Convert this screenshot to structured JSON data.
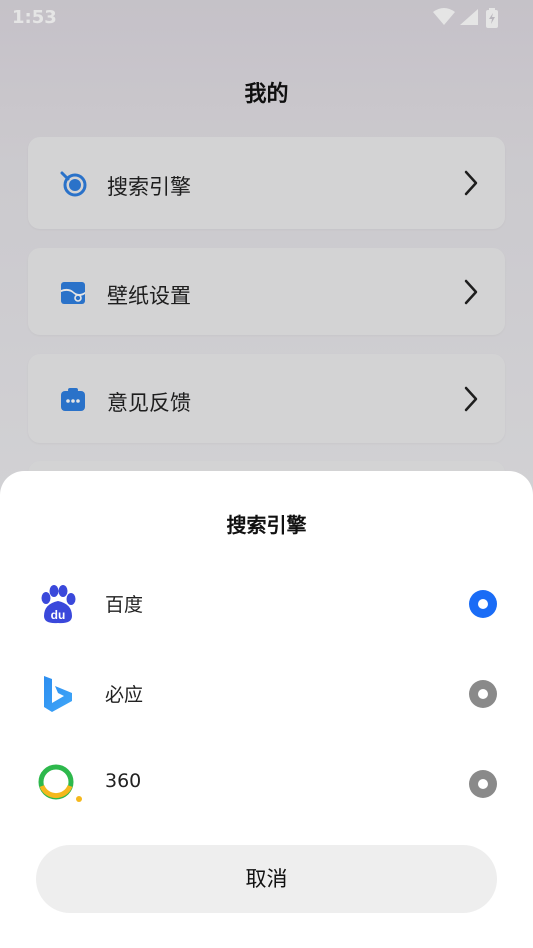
{
  "status_bar": {
    "time": "1:53"
  },
  "page": {
    "title": "我的"
  },
  "menu": [
    {
      "label": "搜索引擎",
      "icon": "search-engine-icon"
    },
    {
      "label": "壁纸设置",
      "icon": "wallpaper-icon"
    },
    {
      "label": "意见反馈",
      "icon": "feedback-icon"
    }
  ],
  "sheet": {
    "title": "搜索引擎",
    "engines": [
      {
        "label": "百度",
        "icon": "baidu-logo-icon",
        "selected": true
      },
      {
        "label": "必应",
        "icon": "bing-logo-icon",
        "selected": false
      },
      {
        "label": "360",
        "icon": "360-logo-icon",
        "selected": false
      }
    ],
    "cancel_label": "取消"
  },
  "colors": {
    "accent": "#1a6cf6",
    "radio_unselected": "#8a8a8a",
    "menu_icon_blue": "#2f7fe0"
  }
}
